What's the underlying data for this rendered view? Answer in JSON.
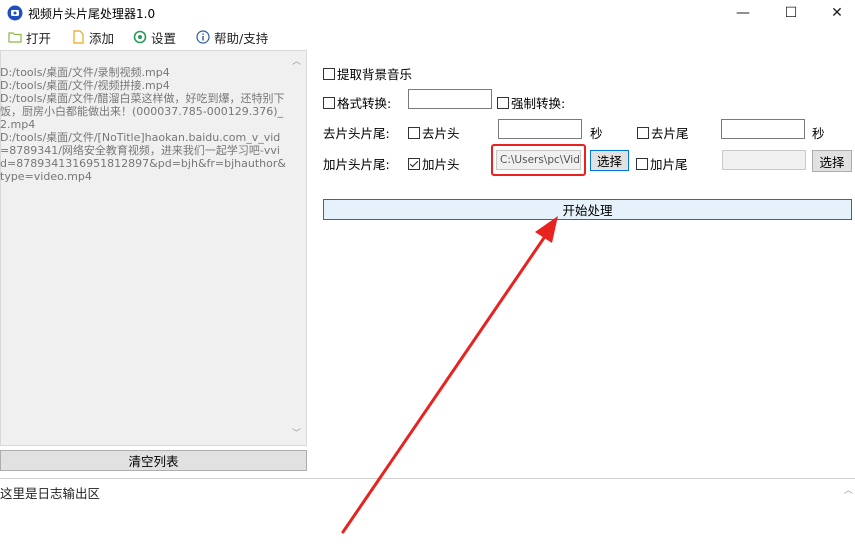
{
  "window": {
    "title": "视频片头片尾处理器1.0",
    "controls": {
      "minimize": "—",
      "maximize": "☐",
      "close": "✕"
    }
  },
  "toolbar": {
    "open": "打开",
    "add": "添加",
    "settings": "设置",
    "help": "帮助/支持"
  },
  "file_list": {
    "text": "D:/tools/桌面/文件/录制视频.mp4\nD:/tools/桌面/文件/视频拼接.mp4\nD:/tools/桌面/文件/醋溜白菜这样做，好吃到爆，还特别下饭，厨房小白都能做出来！(000037.785-000129.376)_2.mp4\nD:/tools/桌面/文件/[NoTitle]haokan.baidu.com_v_vid=8789341/网络安全教育视频，进来我们一起学习吧-vvid=8789341316951812897&pd=bjh&fr=bjhauthor&type=video.mp4",
    "scroll_up": "︿",
    "scroll_down": "﹀",
    "clear_button": "清空列表"
  },
  "options": {
    "extract_music": {
      "label": "提取背景音乐",
      "checked": false
    },
    "format_convert": {
      "label": "格式转换:",
      "checked": false,
      "value": ""
    },
    "force_convert": {
      "label": "强制转换:",
      "checked": false
    },
    "remove_label": "去片头片尾:",
    "remove_head": {
      "label": "去片头",
      "checked": false,
      "value": "",
      "unit": "秒"
    },
    "remove_tail": {
      "label": "去片尾",
      "checked": false,
      "value": "",
      "unit": "秒"
    },
    "add_label": "加片头片尾:",
    "add_head": {
      "label": "加片头",
      "checked": true,
      "path": "C:\\Users\\pc\\Vid",
      "choose": "选择"
    },
    "add_tail": {
      "label": "加片尾",
      "checked": false,
      "path": "",
      "choose": "选择"
    },
    "start_button": "开始处理"
  },
  "log": {
    "text": "这里是日志输出区",
    "scroll": "︿"
  },
  "colors": {
    "annotation": "#e8231f",
    "start_button_border": "#0078d7",
    "start_button_bg": "#e5f1fb"
  }
}
